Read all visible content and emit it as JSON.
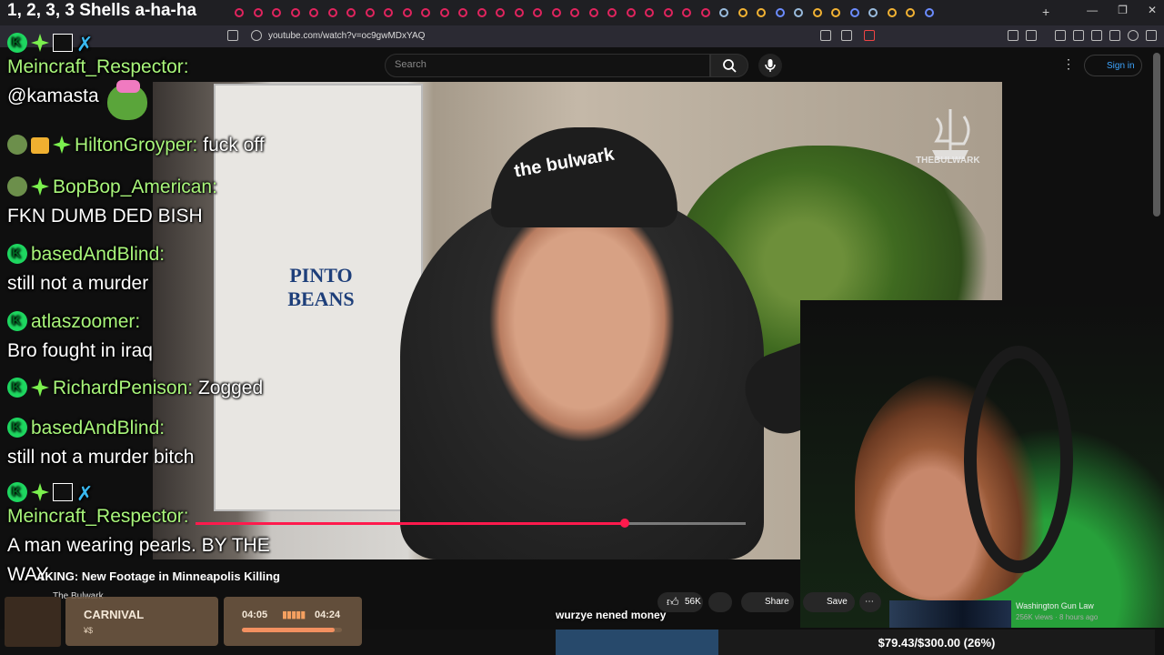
{
  "browser": {
    "tab_title": "1, 2, 3, 3 Shells a-ha-ha",
    "url": "youtube.com/watch?v=oc9gwMDxYAQ",
    "window_controls": [
      "—",
      "❐",
      "✕"
    ]
  },
  "youtube": {
    "search_placeholder": "Search",
    "sign_in": "Sign in",
    "video_title": "New Footage in Minneapolis Killing",
    "video_title_partial_prefix": "AKING:",
    "channel": "The Bulwark",
    "watermark": "THEBULWARK",
    "likes": "56K",
    "share": "Share",
    "save": "Save",
    "progress": 0.78,
    "sidebar": {
      "channel": "Washington Gun Law",
      "meta": "256K views · 8 hours ago"
    }
  },
  "video_scene": {
    "poster_text": "PINTO BEANS",
    "cap_text": "the bulwark"
  },
  "chat": [
    {
      "user": "Meincraft_Respector:",
      "message": "@kamasta",
      "badges": [
        "kick",
        "sparkle",
        "box",
        "sword"
      ]
    },
    {
      "user": "HiltonGroyper:",
      "message": "fuck off",
      "badges": [
        "avatar",
        "gift",
        "sparkle"
      ]
    },
    {
      "user": "BopBop_American:",
      "message": "FKN DUMB DED BISH",
      "badges": [
        "avatar",
        "sparkle"
      ]
    },
    {
      "user": "basedAndBlind:",
      "message": "still not a murder",
      "badges": [
        "kick"
      ]
    },
    {
      "user": "atlaszoomer:",
      "message": "Bro fought in iraq",
      "badges": [
        "kick"
      ]
    },
    {
      "user": "RichardPenison:",
      "message": "Zogged",
      "badges": [
        "kick",
        "sparkle"
      ]
    },
    {
      "user": "basedAndBlind:",
      "message": "still not a murder bitch",
      "badges": [
        "kick"
      ]
    },
    {
      "user": "Meincraft_Respector:",
      "message": "A man wearing pearls. BY THE",
      "badges": [
        "kick",
        "sparkle",
        "box",
        "sword"
      ]
    }
  ],
  "chat_overflow": "WAY",
  "music": {
    "track": "CARNIVAL",
    "artist": "¥$",
    "current_time": "04:05",
    "total_time": "04:24",
    "progress": 0.93
  },
  "caption": "wurzye nened money",
  "donation": "$79.43/$300.00 (26%)",
  "colors": {
    "username": "#a8f57a",
    "accent": "#ff1a4d",
    "kick_badge": "#1ed760"
  }
}
